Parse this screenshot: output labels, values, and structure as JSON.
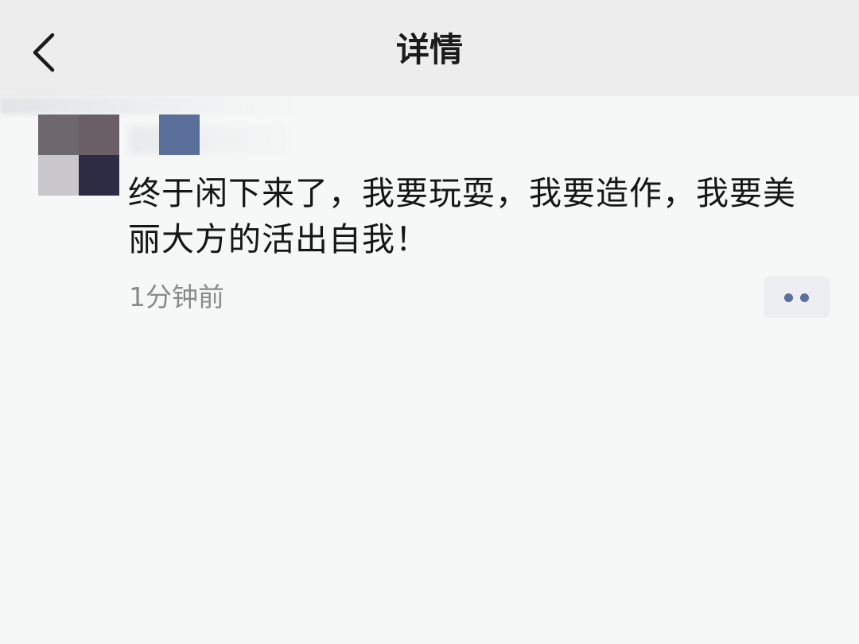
{
  "nav": {
    "title": "详情",
    "back_icon": "chevron-left-icon"
  },
  "post": {
    "text": "终于闲下来了，我要玩耍，我要造作，我要美丽大方的活出自我！",
    "time": "1分钟前",
    "more_icon": "more-dots-icon"
  },
  "colors": {
    "nav_bg": "#ededed",
    "page_bg": "#f6f8f7",
    "accent": "#5a6f99",
    "text": "#161616",
    "muted": "#8a8a8a"
  }
}
